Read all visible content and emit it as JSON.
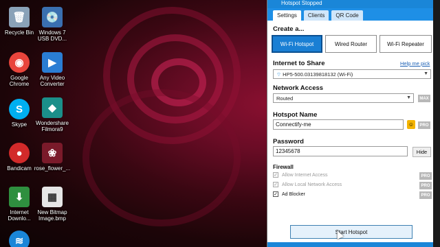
{
  "desktop": {
    "icons": [
      {
        "label": "Recycle Bin",
        "icon": "recycle-bin-icon",
        "color": "#8aa2b8",
        "glyph": "🗑"
      },
      {
        "label": "Windows 7 USB DVD...",
        "icon": "usb-dvd-tool-icon",
        "color": "#3a6fb0",
        "glyph": "💿"
      },
      {
        "label": "Google Chrome",
        "icon": "chrome-icon",
        "color": "#e8453c",
        "glyph": "◉"
      },
      {
        "label": "Any Video Converter",
        "icon": "video-converter-icon",
        "color": "#2a7dd4",
        "glyph": "▶"
      },
      {
        "label": "Skype",
        "icon": "skype-icon",
        "color": "#00aff0",
        "glyph": "S"
      },
      {
        "label": "Wondershare Filmora9",
        "icon": "filmora-icon",
        "color": "#1b8f8a",
        "glyph": "◆"
      },
      {
        "label": "Bandicam",
        "icon": "bandicam-icon",
        "color": "#d22a2a",
        "glyph": "●"
      },
      {
        "label": "rose_flower_...",
        "icon": "image-file-icon",
        "color": "#7a1a2a",
        "glyph": "❀"
      },
      {
        "label": "Internet Downlo...",
        "icon": "idm-icon",
        "color": "#2f8f3f",
        "glyph": "⬇"
      },
      {
        "label": "New Bitmap Image.bmp",
        "icon": "bitmap-file-icon",
        "color": "#e6e6e6",
        "glyph": "▦"
      },
      {
        "label": "",
        "icon": "connectify-icon",
        "color": "#1a86d8",
        "glyph": "≋"
      }
    ]
  },
  "window": {
    "title": "Hotspot Stopped",
    "tabs": [
      "Settings",
      "Clients",
      "QR Code"
    ],
    "create": {
      "title": "Create a...",
      "buttons": [
        "Wi-Fi Hotspot",
        "Wired Router",
        "Wi-Fi Repeater"
      ]
    },
    "internet": {
      "title": "Internet to Share",
      "help": "Help me pick",
      "value": "HP5-500.03139818132 (Wi-Fi)"
    },
    "access": {
      "title": "Network Access",
      "value": "Routed",
      "badge": "MAX"
    },
    "hotspot": {
      "title": "Hotspot Name",
      "value": "Connectify-me",
      "badge": "PRO"
    },
    "password": {
      "title": "Password",
      "value": "12345678",
      "hide": "Hide"
    },
    "firewall": {
      "title": "Firewall",
      "items": [
        {
          "label": "Allow Internet Access",
          "badge": "PRO"
        },
        {
          "label": "Allow Local Network Access",
          "badge": "PRO"
        },
        {
          "label": "Ad Blocker",
          "badge": "PRO"
        }
      ]
    },
    "start": "Start Hotspot"
  },
  "colors": {
    "accent": "#1a86d8",
    "active_button": "#1a7fd4"
  }
}
